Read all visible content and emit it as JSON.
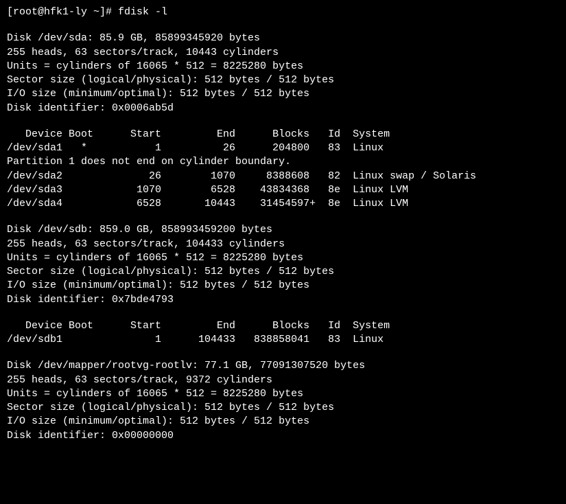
{
  "prompt": "[root@hfk1-ly ~]# fdisk -l",
  "sda": {
    "header": "Disk /dev/sda: 85.9 GB, 85899345920 bytes",
    "geom": "255 heads, 63 sectors/track, 10443 cylinders",
    "units": "Units = cylinders of 16065 * 512 = 8225280 bytes",
    "sector": "Sector size (logical/physical): 512 bytes / 512 bytes",
    "iosize": "I/O size (minimum/optimal): 512 bytes / 512 bytes",
    "diskid": "Disk identifier: 0x0006ab5d",
    "thead": "   Device Boot      Start         End      Blocks   Id  System",
    "p1": "/dev/sda1   *           1          26      204800   83  Linux",
    "note": "Partition 1 does not end on cylinder boundary.",
    "p2": "/dev/sda2              26        1070     8388608   82  Linux swap / Solaris",
    "p3": "/dev/sda3            1070        6528    43834368   8e  Linux LVM",
    "p4": "/dev/sda4            6528       10443    31454597+  8e  Linux LVM"
  },
  "sdb": {
    "header": "Disk /dev/sdb: 859.0 GB, 858993459200 bytes",
    "geom": "255 heads, 63 sectors/track, 104433 cylinders",
    "units": "Units = cylinders of 16065 * 512 = 8225280 bytes",
    "sector": "Sector size (logical/physical): 512 bytes / 512 bytes",
    "iosize": "I/O size (minimum/optimal): 512 bytes / 512 bytes",
    "diskid": "Disk identifier: 0x7bde4793",
    "thead": "   Device Boot      Start         End      Blocks   Id  System",
    "p1": "/dev/sdb1               1      104433   838858041   83  Linux"
  },
  "rootlv": {
    "header": "Disk /dev/mapper/rootvg-rootlv: 77.1 GB, 77091307520 bytes",
    "geom": "255 heads, 63 sectors/track, 9372 cylinders",
    "units": "Units = cylinders of 16065 * 512 = 8225280 bytes",
    "sector": "Sector size (logical/physical): 512 bytes / 512 bytes",
    "iosize": "I/O size (minimum/optimal): 512 bytes / 512 bytes",
    "diskid": "Disk identifier: 0x00000000"
  }
}
